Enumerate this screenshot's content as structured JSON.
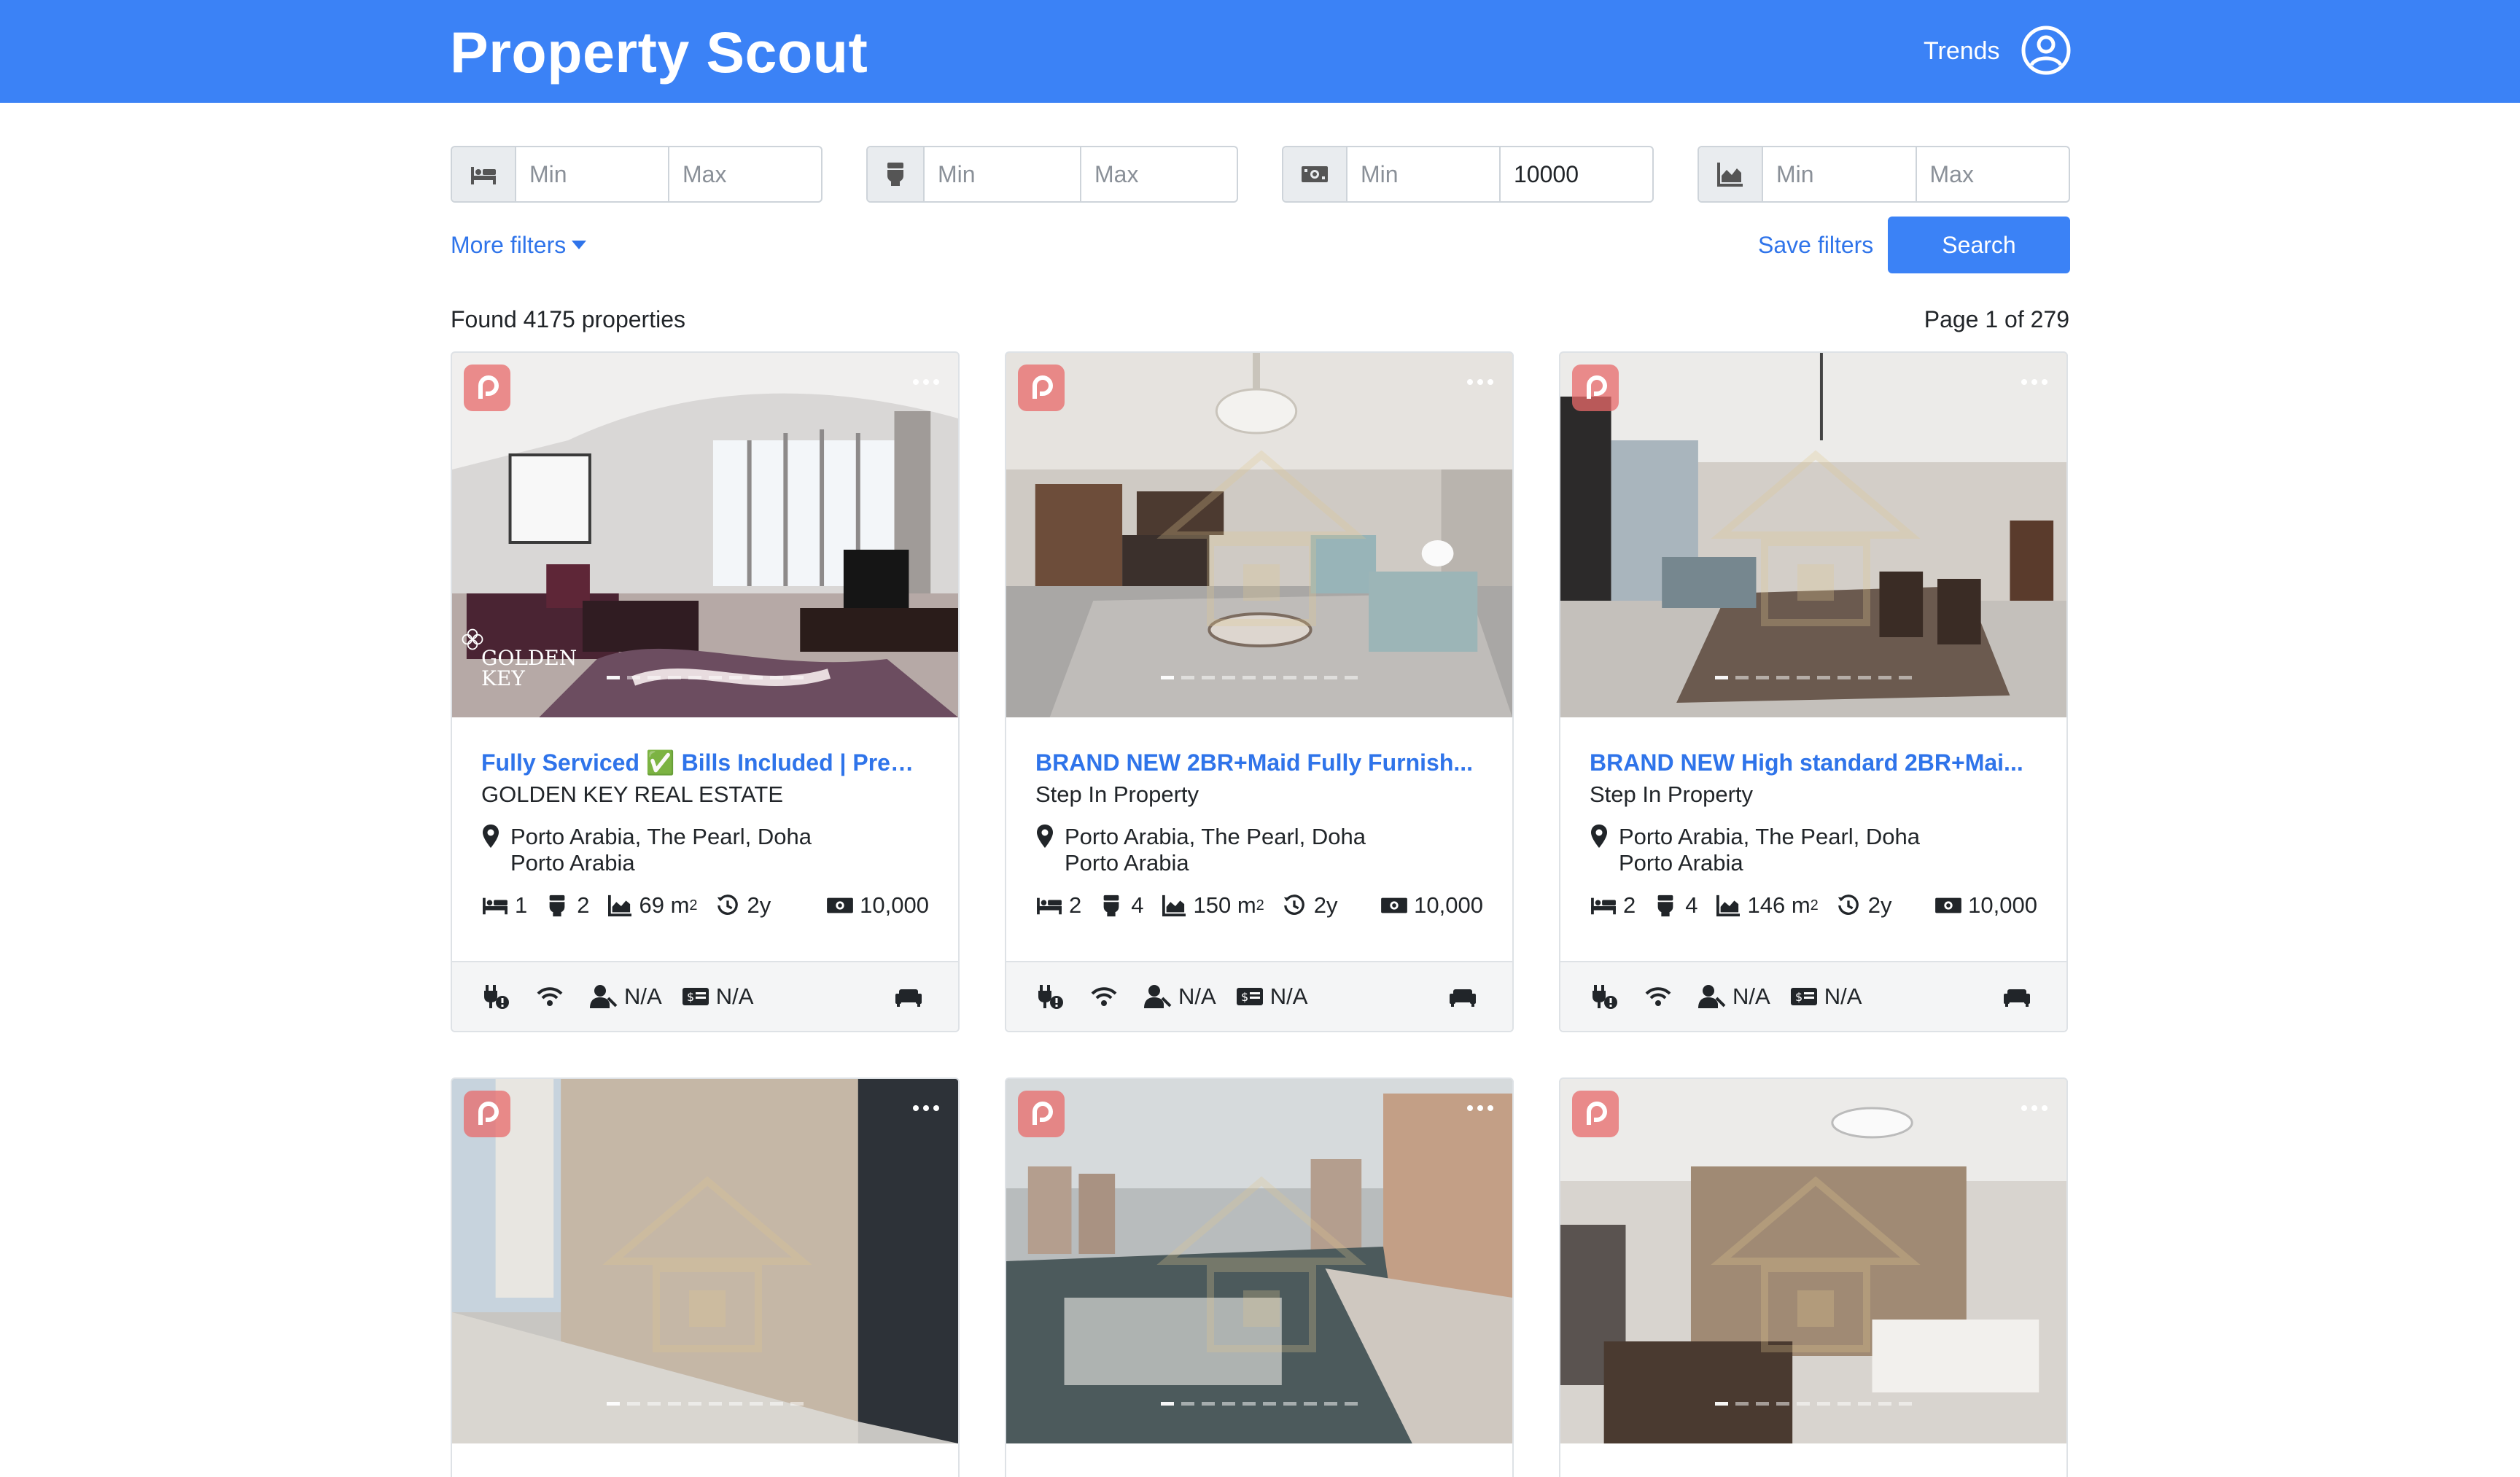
{
  "app": {
    "title": "Property Scout"
  },
  "nav": {
    "trends": "Trends",
    "user_icon": "user-circle-icon"
  },
  "filters": {
    "bedrooms": {
      "icon": "bed-icon",
      "min_placeholder": "Min",
      "max_placeholder": "Max"
    },
    "bathrooms": {
      "icon": "toilet-icon",
      "min_placeholder": "Min",
      "max_placeholder": "Max"
    },
    "price": {
      "icon": "money-icon",
      "min_placeholder": "Min",
      "max_value": "10000"
    },
    "area": {
      "icon": "area-chart-icon",
      "min_placeholder": "Min",
      "max_placeholder": "Max"
    },
    "more_filters": "More filters",
    "save_filters": "Save filters",
    "search": "Search"
  },
  "results": {
    "found": "Found 4175 properties",
    "page": "Page 1 of 279"
  },
  "colors": {
    "primary": "#3b82f6",
    "link": "#2f74ea",
    "badge": "#e86969"
  },
  "listings": [
    {
      "title": "Fully Serviced ✅ Bills Included | Prem...",
      "agency": "GOLDEN KEY REAL ESTATE",
      "location_line1": "Porto Arabia, The Pearl, Doha",
      "location_line2": "Porto Arabia",
      "beds": "1",
      "baths": "2",
      "area": "69 m",
      "area_sup": "2",
      "age": "2y",
      "price": "10,000",
      "na1": "N/A",
      "na2": "N/A",
      "logo_text_1": "GOLDEN",
      "logo_text_2": "KEY"
    },
    {
      "title": "BRAND NEW 2BR+Maid Fully Furnish...",
      "agency": "Step In Property",
      "location_line1": "Porto Arabia, The Pearl, Doha",
      "location_line2": "Porto Arabia",
      "beds": "2",
      "baths": "4",
      "area": "150 m",
      "area_sup": "2",
      "age": "2y",
      "price": "10,000",
      "na1": "N/A",
      "na2": "N/A"
    },
    {
      "title": "BRAND NEW High standard 2BR+Mai...",
      "agency": "Step In Property",
      "location_line1": "Porto Arabia, The Pearl, Doha",
      "location_line2": "Porto Arabia",
      "beds": "2",
      "baths": "4",
      "area": "146 m",
      "area_sup": "2",
      "age": "2y",
      "price": "10,000",
      "na1": "N/A",
      "na2": "N/A"
    }
  ]
}
